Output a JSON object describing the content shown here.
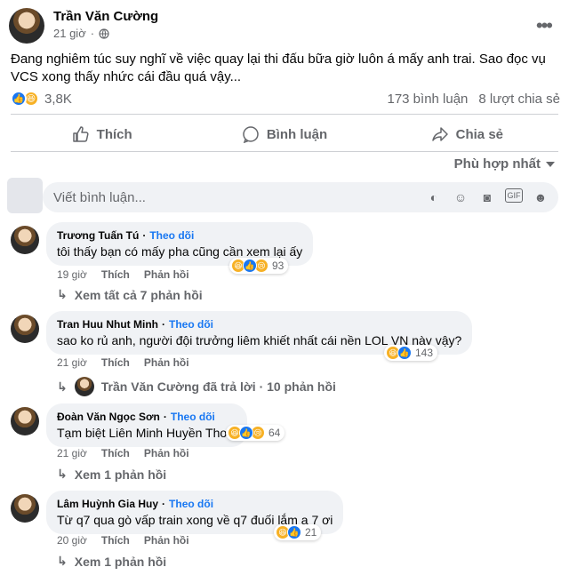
{
  "post": {
    "author": "Trần Văn Cường",
    "time": "21 giờ",
    "text": "Đang nghiêm túc suy nghĩ về việc quay lại thi đấu bữa giờ luôn á mấy anh trai. Sao đọc vụ VCS xong thấy nhức cái đầu quá vậy...",
    "reaction_count": "3,8K",
    "comment_count": "173 bình luận",
    "share_count": "8 lượt chia sẻ"
  },
  "actions": {
    "like": "Thích",
    "comment": "Bình luận",
    "share": "Chia sẻ"
  },
  "sort_label": "Phù hợp nhất",
  "composer": {
    "placeholder": "Viết bình luận..."
  },
  "comments": [
    {
      "name": "Trương Tuấn Tú",
      "follow": "Theo dõi",
      "text": "tôi thấy bạn có mấy pha cũng cần xem lại ấy",
      "reactions": "93",
      "time": "19 giờ",
      "like": "Thích",
      "reply": "Phản hồi",
      "replies": "Xem tất cả 7 phản hồi"
    },
    {
      "name": "Tran Huu Nhut Minh",
      "follow": "Theo dõi",
      "text": "sao ko rủ anh, người đội trưởng liêm khiết nhất cái nền LOL VN này vậy?",
      "reactions": "143",
      "time": "21 giờ",
      "like": "Thích",
      "reply": "Phản hồi",
      "replies": "Trần Văn Cường đã trả lời · 10 phản hồi"
    },
    {
      "name": "Đoàn Văn Ngọc Sơn",
      "follow": "Theo dõi",
      "text": "Tạm biệt Liên Minh Huyền Thoại",
      "reactions": "64",
      "time": "21 giờ",
      "like": "Thích",
      "reply": "Phản hồi",
      "replies": "Xem 1 phản hồi"
    },
    {
      "name": "Lâm Huỳnh Gia Huy",
      "follow": "Theo dõi",
      "text": "Từ q7 qua gò vấp train xong về q7 đuối lắm a 7 ơi",
      "reactions": "21",
      "time": "20 giờ",
      "like": "Thích",
      "reply": "Phản hồi",
      "replies": "Xem 1 phản hồi"
    }
  ]
}
